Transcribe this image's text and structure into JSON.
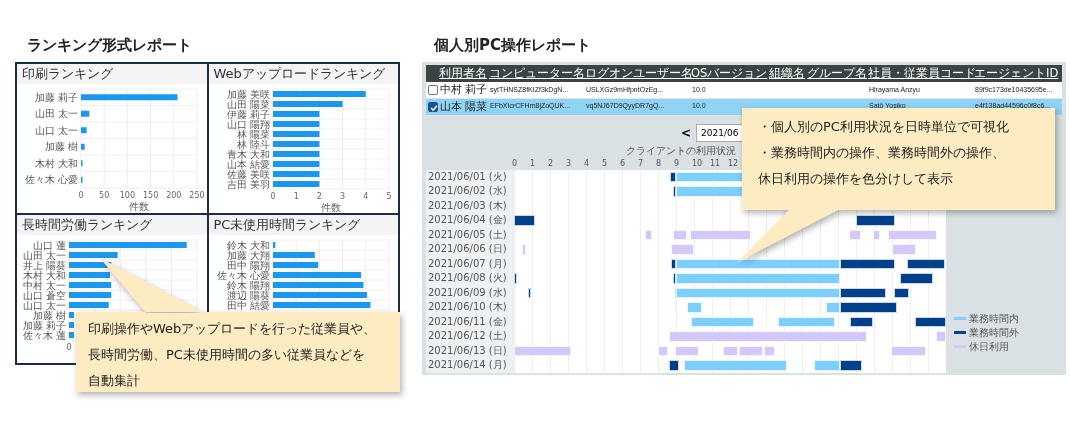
{
  "ranking_report": {
    "title": "ランキング形式レポート",
    "cards": [
      {
        "title": "印刷ランキング",
        "chart_data": {
          "type": "bar",
          "orientation": "horizontal",
          "grid": true,
          "xlabel": "件数",
          "categories": [
            "加藤 莉子",
            "山田 太一",
            "山口 太一",
            "加藤 樹",
            "木村 大和",
            "佐々木 心愛"
          ],
          "values": [
            208,
            18,
            12,
            8,
            3,
            1
          ],
          "xlim": [
            0,
            250
          ],
          "xticks": [
            0,
            50,
            100,
            150,
            200,
            250
          ]
        }
      },
      {
        "title": "Webアップロードランキング",
        "chart_data": {
          "type": "bar",
          "orientation": "horizontal",
          "grid": true,
          "xlabel": "件数",
          "categories": [
            "加藤 美咲",
            "山田 陽菜",
            "伊藤 莉子",
            "山口 陽翔",
            "林 陽菜",
            "林 陸斗",
            "青木 大和",
            "山本 結愛",
            "佐藤 美咲",
            "吉田 美羽"
          ],
          "values": [
            4,
            3,
            2,
            2,
            2,
            2,
            2,
            2,
            2,
            2
          ],
          "xlim": [
            0,
            5
          ],
          "xticks": [
            0,
            1,
            2,
            3,
            4,
            5
          ]
        }
      },
      {
        "title": "長時間労働ランキング",
        "categories": [
          "山口 蓮",
          "山田 太一",
          "井上 陽葵",
          "木村 大和",
          "中村 太一",
          "山口 蒼空",
          "山口 太一",
          "加藤 樹",
          "加藤 莉子",
          "佐々木 蓮"
        ],
        "tick": "0"
      },
      {
        "title": "PC未使用時間ランキング",
        "categories": [
          "鈴木 大和",
          "加藤 大翔",
          "田中 陽翔",
          "佐々木 心愛",
          "鈴木 陽翔",
          "渡辺 陽葵",
          "田中 結愛"
        ]
      }
    ],
    "callout": [
      "印刷操作やWebアップロードを行った従業員や、",
      "長時間労働、PC未使用時間の多い従業員などを",
      "自動集計"
    ]
  },
  "pc_report": {
    "title": "個人別PC操作レポート",
    "table": {
      "columns": [
        "利用者名",
        "コンピューター名",
        "ログオンユーザー名",
        "OSバージョン",
        "組織名",
        "グループ名",
        "社員・従業員コード",
        "エージェントID"
      ],
      "rows": [
        {
          "selected": false,
          "cells": [
            "中村 莉子",
            "sytTHNSZ8fKIZf3kDgN...",
            "USLXGz9mHfpntOzEg...",
            "10.0",
            "",
            "",
            "Hirayama Anzyu",
            "89f9c173de10435695e..."
          ]
        },
        {
          "selected": true,
          "cells": [
            "山本 陽菜",
            "EFbXIcrCFHm8jZoQUK...",
            "vq5NJ67D9QyyDR7gQ...",
            "10.0",
            "",
            "",
            "Satō Yosiko",
            "e4f138ad44596c0f8c6..."
          ]
        }
      ]
    },
    "prev_button": "<",
    "month": "2021/06",
    "chart_title": "クライアントの利用状況",
    "hours": [
      "0",
      "1",
      "2",
      "3",
      "4",
      "5",
      "6",
      "7",
      "8",
      "9",
      "10",
      "11",
      "12"
    ],
    "dates": [
      "2021/06/01 (火)",
      "2021/06/02 (水)",
      "2021/06/03 (木)",
      "2021/06/04 (金)",
      "2021/06/05 (土)",
      "2021/06/06 (日)",
      "2021/06/07 (月)",
      "2021/06/08 (火)",
      "2021/06/09 (水)",
      "2021/06/10 (木)",
      "2021/06/11 (金)",
      "2021/06/12 (土)",
      "2021/06/13 (日)",
      "2021/06/14 (月)"
    ],
    "legend": [
      {
        "kind": "work",
        "label": "業務時間内"
      },
      {
        "kind": "overtime",
        "label": "業務時間外"
      },
      {
        "kind": "holiday",
        "label": "休日利用"
      }
    ],
    "callout": [
      "・個人別のPC利用状況を日時単位で可視化",
      "・業務時間内の操作、業務時間外の操作、",
      "休日利用の操作を色分けして表示"
    ]
  }
}
